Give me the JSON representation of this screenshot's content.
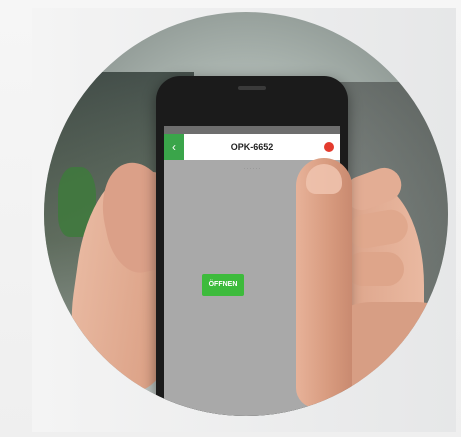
{
  "screen": {
    "title": "OPK-6652",
    "subtitle": "· · · · · ·",
    "back_icon": "‹",
    "open_button_label": "ÖFFNEN"
  },
  "colors": {
    "header_green": "#3aa54a",
    "open_green": "#3dbb3c",
    "settings_red": "#e43b2e",
    "orange_button": "#f08c1a"
  },
  "icons": [
    "chevron-left-icon",
    "settings-icon"
  ]
}
